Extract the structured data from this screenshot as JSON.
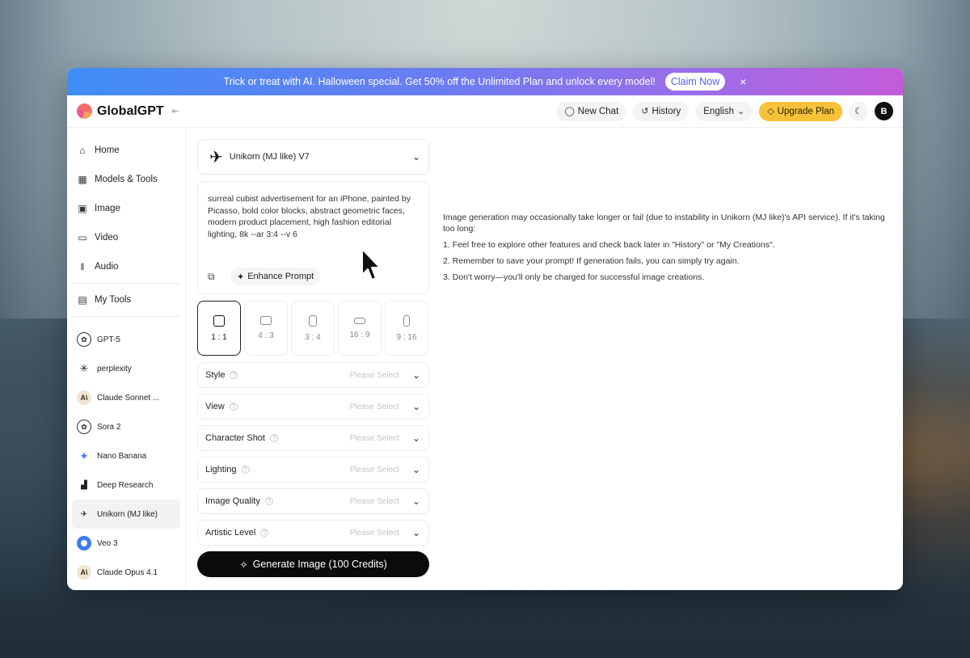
{
  "promo": {
    "message": "Trick or treat with AI. Halloween special. Get 50% off the Unlimited Plan and unlock every model!",
    "cta": "Claim Now",
    "close": "×"
  },
  "header": {
    "brand": "GlobalGPT",
    "new_chat": "New Chat",
    "history": "History",
    "language": "English",
    "upgrade": "Upgrade Plan",
    "avatar_initial": "B"
  },
  "sidebar": {
    "nav": [
      {
        "label": "Home",
        "icon": "home-icon"
      },
      {
        "label": "Models & Tools",
        "icon": "grid-icon"
      },
      {
        "label": "Image",
        "icon": "image-icon"
      },
      {
        "label": "Video",
        "icon": "video-icon"
      },
      {
        "label": "Audio",
        "icon": "audio-icon"
      },
      {
        "label": "My Tools",
        "icon": "tools-icon"
      }
    ],
    "models": [
      {
        "label": "GPT-5"
      },
      {
        "label": "perplexity"
      },
      {
        "label": "Claude Sonnet ..."
      },
      {
        "label": "Sora 2"
      },
      {
        "label": "Nano Banana"
      },
      {
        "label": "Deep Research"
      },
      {
        "label": "Unikorn (MJ like)"
      },
      {
        "label": "Veo 3"
      },
      {
        "label": "Claude Opus 4.1"
      }
    ]
  },
  "form": {
    "model": "Unikorn (MJ like) V7",
    "prompt": "surreal cubist advertisement for an iPhone, painted by Picasso, bold color blocks, abstract geometric faces, modern product placement, high fashion editorial lighting, 8k --ar 3:4 --v 6",
    "enhance": "Enhance Prompt",
    "ratios": [
      "1 : 1",
      "4 : 3",
      "3 : 4",
      "16 : 9",
      "9 : 16"
    ],
    "selected_ratio": "1 : 1",
    "selects": [
      {
        "label": "Style",
        "placeholder": "Please Select"
      },
      {
        "label": "View",
        "placeholder": "Please Select"
      },
      {
        "label": "Character Shot",
        "placeholder": "Please Select"
      },
      {
        "label": "Lighting",
        "placeholder": "Please Select"
      },
      {
        "label": "Image Quality",
        "placeholder": "Please Select"
      },
      {
        "label": "Artistic Level",
        "placeholder": "Please Select"
      }
    ],
    "generate": "Generate Image (100 Credits)"
  },
  "notice": {
    "intro": "Image generation may occasionally take longer or fail (due to instability in Unikorn (MJ like)'s API service). If it's taking too long:",
    "items": [
      "1. Feel free to explore other features and check back later in \"History\" or \"My Creations\".",
      "2. Remember to save your prompt! If generation fails, you can simply try again.",
      "3. Don't worry—you'll only be charged for successful image creations."
    ]
  }
}
